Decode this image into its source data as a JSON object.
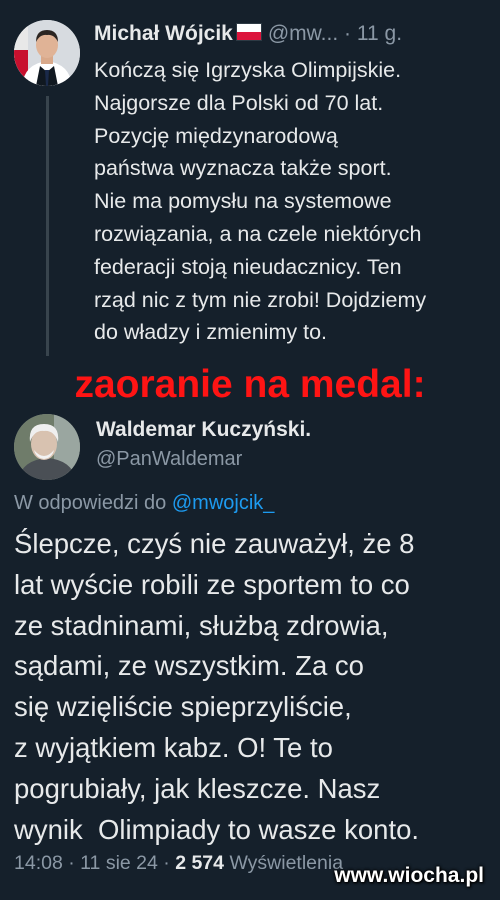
{
  "tweet1": {
    "author_name": "Michał Wójcik",
    "author_handle": "@mw...",
    "separator": "·",
    "time": "11 g.",
    "flag_icon": "poland-flag-icon",
    "text_lines": [
      "Kończą się Igrzyska Olimpijskie.",
      "Najgorsze dla Polski od 70 lat.",
      "Pozycję międzynarodową",
      "państwa wyznacza także sport.",
      "Nie ma pomysłu na systemowe",
      "rozwiązania, a na czele niektórych",
      "federacji stoją nieudacznicy. Ten",
      "rząd nic z tym nie zrobi! Dojdziemy",
      "do władzy i zmienimy to."
    ]
  },
  "banner": "zaoranie na medal:",
  "tweet2": {
    "author_name": "Waldemar Kuczyński.",
    "author_handle": "@PanWaldemar",
    "replying_prefix": "W odpowiedzi do",
    "replying_mention": "@mwojcik_",
    "text_lines": [
      "Ślepcze, czyś nie zauważył, że 8",
      "lat wyście robili ze sportem to co",
      "ze stadninami, służbą zdrowia,",
      "sądami, ze wszystkim. Za co",
      "się wzięliście spieprzyliście,",
      "z wyjątkiem kabz. O! Te to",
      "pogrubiały, jak kleszcze. Nasz",
      "wynik  Olimpiady to wasze konto."
    ],
    "footer": {
      "time": "14:08",
      "sep1": "·",
      "date": "11 sie 24",
      "sep2": "·",
      "views_count": "2 574",
      "views_label": "Wyświetlenia"
    }
  },
  "watermark": "www.wiocha.pl",
  "colors": {
    "background": "#15202b",
    "text": "#e7e9ea",
    "secondary": "#8b98a5",
    "link": "#1d9bf0",
    "banner": "#ff1414"
  }
}
